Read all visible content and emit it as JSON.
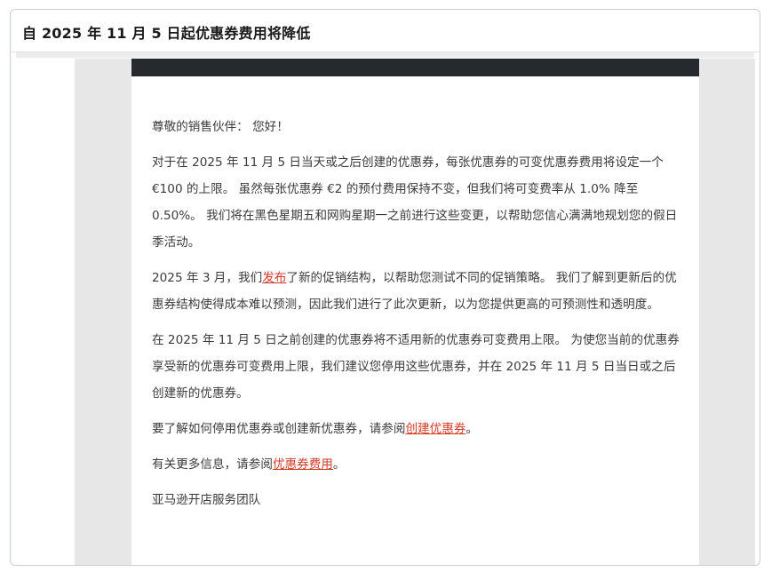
{
  "page_title": "自 2025 年 11 月 5 日起优惠券费用将降低",
  "email": {
    "greeting": "尊敬的销售伙伴： 您好！",
    "para1": "对于在 2025 年 11 月 5 日当天或之后创建的优惠券，每张优惠券的可变优惠券费用将设定一个 €100 的上限。 虽然每张优惠券 €2 的预付费用保持不变，但我们将可变费率从 1.0% 降至 0.50%。 我们将在黑色星期五和网购星期一之前进行这些变更，以帮助您信心满满地规划您的假日季活动。",
    "para2_before": "2025 年 3 月，我们",
    "para2_link": "发布",
    "para2_after": "了新的促销结构，以帮助您测试不同的促销策略。 我们了解到更新后的优惠券结构使得成本难以预测，因此我们进行了此次更新，以为您提供更高的可预测性和透明度。",
    "para3": "在 2025 年 11 月 5 日之前创建的优惠券将不适用新的优惠券可变费用上限。 为使您当前的优惠券享受新的优惠券可变费用上限，我们建议您停用这些优惠券，并在 2025 年 11 月 5 日当日或之后创建新的优惠券。",
    "para4_before": "要了解如何停用优惠券或创建新优惠券，请参阅",
    "para4_link": "创建优惠券",
    "para4_after": "。",
    "para5_before": "有关更多信息，请参阅",
    "para5_link": "优惠券费用",
    "para5_after": "。",
    "signature": "亚马逊开店服务团队"
  },
  "colors": {
    "link": "#d43a2a",
    "header_bar": "#262a2f",
    "viewer_background": "#e7e7e7"
  }
}
